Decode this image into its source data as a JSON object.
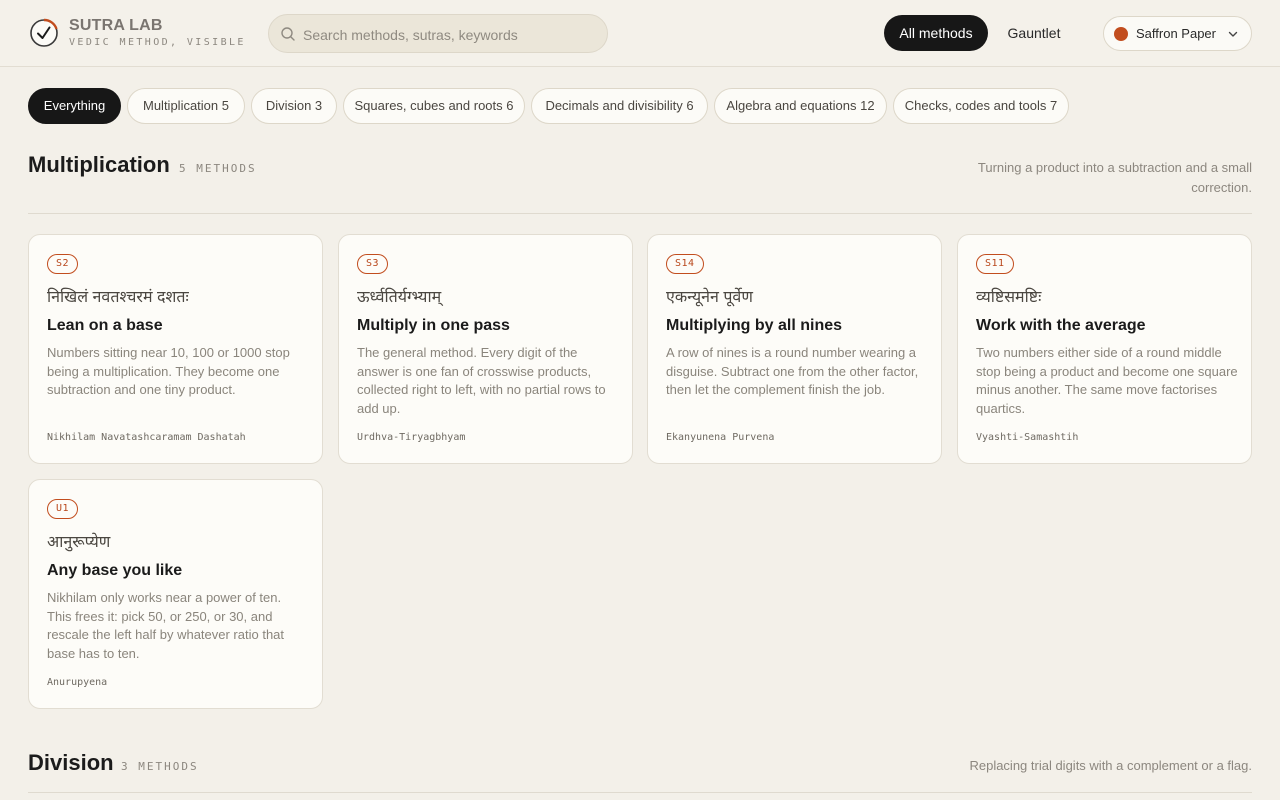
{
  "brand": {
    "name": "SUTRA LAB",
    "tagline": "VEDIC METHOD, VISIBLE"
  },
  "search": {
    "placeholder": "Search methods, sutras, keywords",
    "value": ""
  },
  "nav": {
    "all_methods": "All methods",
    "gauntlet": "Gauntlet"
  },
  "theme": {
    "label": "Saffron Paper",
    "color": "#c24d1e"
  },
  "filters": [
    {
      "label": "Everything",
      "active": true
    },
    {
      "label": "Multiplication 5"
    },
    {
      "label": "Division 3"
    },
    {
      "label": "Squares, cubes and roots 6"
    },
    {
      "label": "Decimals and divisibility 6"
    },
    {
      "label": "Algebra and equations 12"
    },
    {
      "label": "Checks, codes and tools 7"
    }
  ],
  "sections": [
    {
      "title": "Multiplication",
      "count": "5 METHODS",
      "description": "Turning a product into a subtraction and a small correction.",
      "cards": [
        {
          "badge": "S2",
          "sanskrit": "निखिलं नवतश्चरमं दशतः",
          "title": "Lean on a base",
          "description": "Numbers sitting near 10, 100 or 1000 stop being a multiplication. They become one subtraction and one tiny product.",
          "translit": "Nikhilam Navatashcaramam Dashatah"
        },
        {
          "badge": "S3",
          "sanskrit": "ऊर्ध्वतिर्यग्भ्याम्",
          "title": "Multiply in one pass",
          "description": "The general method. Every digit of the answer is one fan of crosswise products, collected right to left, with no partial rows to add up.",
          "translit": "Urdhva-Tiryagbhyam"
        },
        {
          "badge": "S14",
          "sanskrit": "एकन्यूनेन पूर्वेण",
          "title": "Multiplying by all nines",
          "description": "A row of nines is a round number wearing a disguise. Subtract one from the other factor, then let the complement finish the job.",
          "translit": "Ekanyunena Purvena"
        },
        {
          "badge": "S11",
          "sanskrit": "व्यष्टिसमष्टिः",
          "title": "Work with the average",
          "description": "Two numbers either side of a round middle stop being a product and become one square minus another. The same move factorises quartics.",
          "translit": "Vyashti-Samashtih"
        },
        {
          "badge": "U1",
          "sanskrit": "आनुरूप्येण",
          "title": "Any base you like",
          "description": "Nikhilam only works near a power of ten. This frees it: pick 50, or 250, or 30, and rescale the left half by whatever ratio that base has to ten.",
          "translit": "Anurupyena"
        }
      ]
    },
    {
      "title": "Division",
      "count": "3 METHODS",
      "description": "Replacing trial digits with a complement or a flag."
    }
  ]
}
